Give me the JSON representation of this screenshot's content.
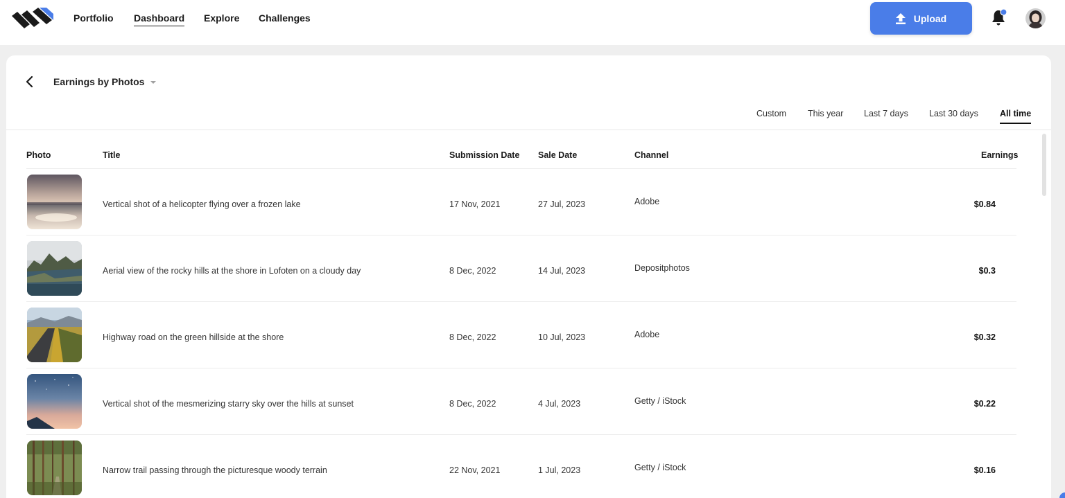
{
  "nav": {
    "items": [
      {
        "label": "Portfolio",
        "active": false
      },
      {
        "label": "Dashboard",
        "active": true
      },
      {
        "label": "Explore",
        "active": false
      },
      {
        "label": "Challenges",
        "active": false
      }
    ],
    "upload_label": "Upload",
    "accent": "#4a7de8"
  },
  "page": {
    "title": "Earnings by Photos",
    "ranges": [
      {
        "label": "Custom",
        "active": false
      },
      {
        "label": "This year",
        "active": false
      },
      {
        "label": "Last 7 days",
        "active": false
      },
      {
        "label": "Last 30 days",
        "active": false
      },
      {
        "label": "All time",
        "active": true
      }
    ]
  },
  "table": {
    "headers": {
      "photo": "Photo",
      "title": "Title",
      "submission_date": "Submission Date",
      "sale_date": "Sale Date",
      "channel": "Channel",
      "earnings": "Earnings"
    },
    "rows": [
      {
        "title": "Vertical shot of a helicopter flying over a frozen lake",
        "submission_date": "17 Nov, 2021",
        "sale_date": "27 Jul, 2023",
        "channel": "Adobe",
        "earnings": "$0.84",
        "thumb": "frozen-lake"
      },
      {
        "title": "Aerial view of the rocky hills at the shore in Lofoten on a cloudy day",
        "submission_date": "8 Dec, 2022",
        "sale_date": "14 Jul, 2023",
        "channel": "Depositphotos",
        "earnings": "$0.3",
        "thumb": "lofoten-hills"
      },
      {
        "title": "Highway road on the green hillside at the shore",
        "submission_date": "8 Dec, 2022",
        "sale_date": "10 Jul, 2023",
        "channel": "Adobe",
        "earnings": "$0.32",
        "thumb": "highway-road"
      },
      {
        "title": "Vertical shot of the mesmerizing starry sky over the hills at sunset",
        "submission_date": "8 Dec, 2022",
        "sale_date": "4 Jul, 2023",
        "channel": "Getty / iStock",
        "earnings": "$0.22",
        "thumb": "starry-sky"
      },
      {
        "title": "Narrow trail passing through the picturesque woody terrain",
        "submission_date": "22 Nov, 2021",
        "sale_date": "1 Jul, 2023",
        "channel": "Getty / iStock",
        "earnings": "$0.16",
        "thumb": "forest-trail"
      }
    ]
  },
  "icons": {
    "logo": "brand-logo",
    "upload": "upload-arrow-icon",
    "notifications": "bell-icon",
    "back": "chevron-left-icon",
    "dropdown": "caret-down-icon"
  }
}
